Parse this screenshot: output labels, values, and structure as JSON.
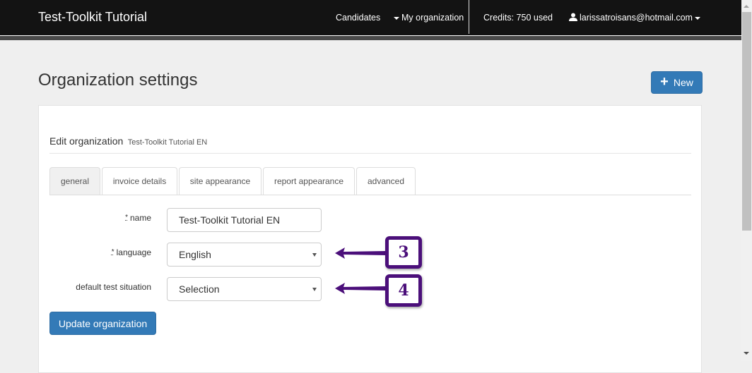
{
  "navbar": {
    "brand": "Test-Toolkit Tutorial",
    "items": {
      "candidates": "Candidates",
      "my_organization": "My organization",
      "credits": "Credits: 750 used",
      "user_email": "larissatroisans@hotmail.com"
    }
  },
  "page": {
    "title": "Organization settings",
    "new_button": "New",
    "new_icon": "plus-icon"
  },
  "panel": {
    "heading": "Edit organization",
    "heading_sub": "Test-Toolkit Tutorial EN",
    "tabs": [
      {
        "label": "general",
        "active": true
      },
      {
        "label": "invoice details",
        "active": false
      },
      {
        "label": "site appearance",
        "active": false
      },
      {
        "label": "report appearance",
        "active": false
      },
      {
        "label": "advanced",
        "active": false
      }
    ],
    "form": {
      "required_mark": "*",
      "name_label": "name",
      "name_value": "Test-Toolkit Tutorial EN",
      "language_label": "language",
      "language_value": "English",
      "situation_label": "default test situation",
      "situation_value": "Selection"
    },
    "update_button": "Update organization"
  },
  "annotations": {
    "callout_3": "3",
    "callout_4": "4",
    "color": "#4b0f7a"
  }
}
